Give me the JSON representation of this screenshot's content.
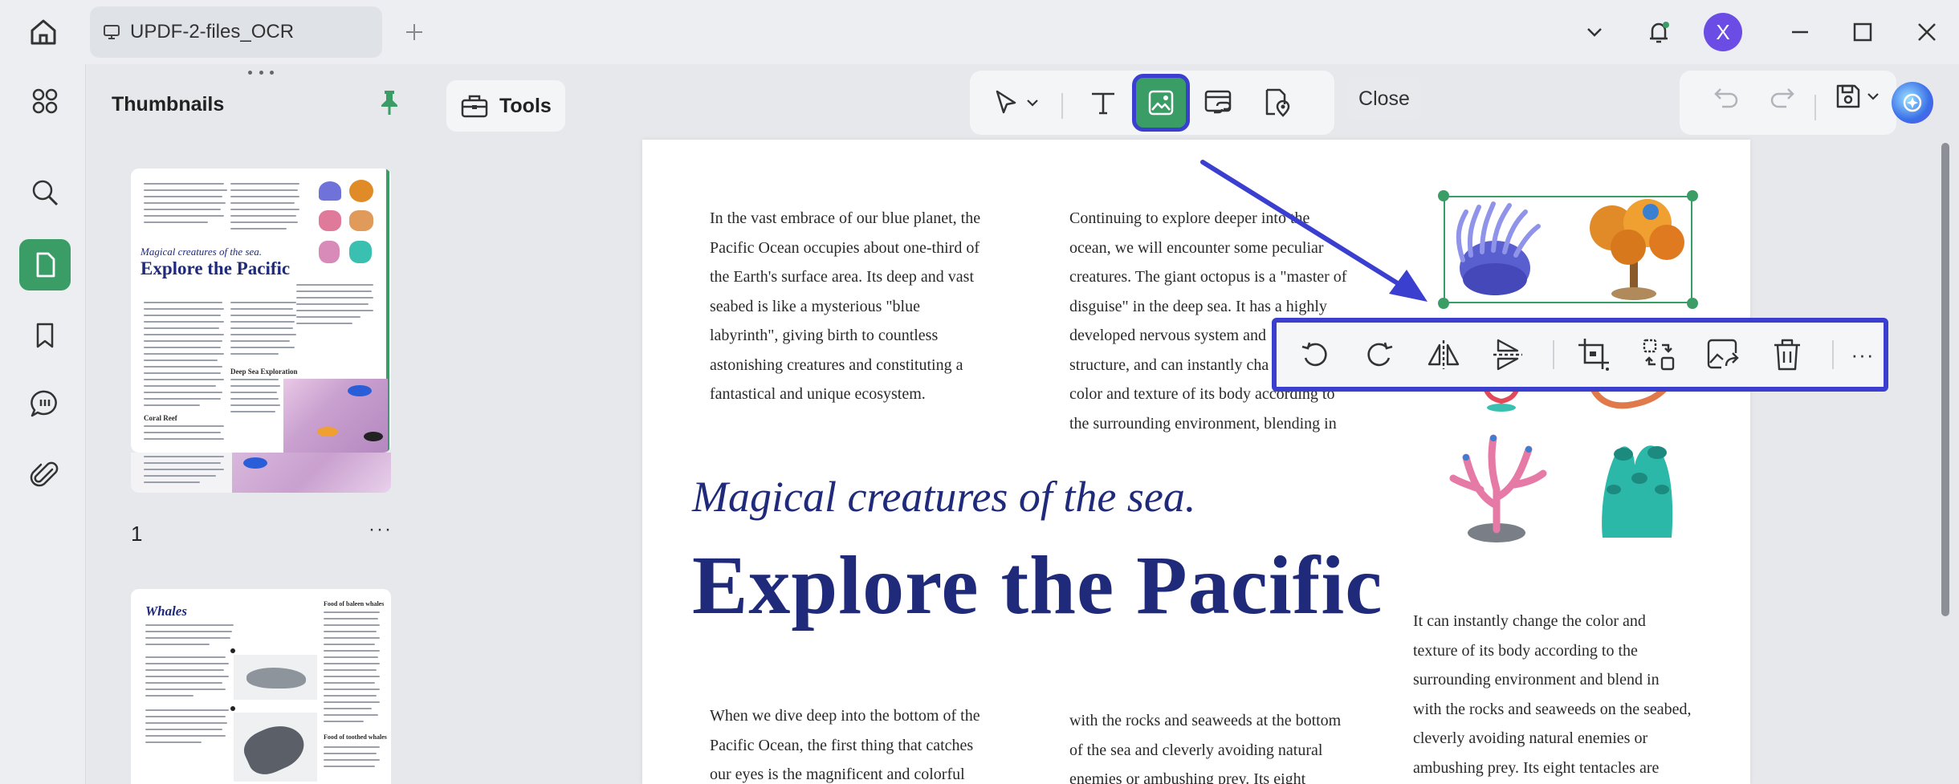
{
  "titlebar": {
    "tab_title": "UPDF-2-files_OCR",
    "avatar_letter": "X"
  },
  "rail": {
    "items": [
      "apps-icon",
      "search-icon",
      "page-icon",
      "bookmark-icon",
      "comment-icon",
      "attachment-icon"
    ],
    "active": "page-icon"
  },
  "thumbnails": {
    "title": "Thumbnails",
    "pages": [
      {
        "number": "1",
        "more": "···",
        "italic": "Magical creatures of the sea.",
        "heading": "Explore the Pacific",
        "subheading_1": "Deep Sea Exploration",
        "subheading_2": "Coral Reef"
      },
      {
        "heading": "Whales",
        "subheading_1": "Food of baleen whales",
        "subheading_2": "Food of toothed whales"
      }
    ]
  },
  "toolbar": {
    "tools_label": "Tools",
    "close_label": "Close"
  },
  "document": {
    "col1_para1": [
      "In the vast embrace of our blue planet, the",
      "Pacific Ocean occupies about one-third of",
      "the Earth's surface area. Its deep and vast",
      "seabed is like a mysterious \"blue",
      "labyrinth\", giving birth to countless",
      "astonishing creatures and constituting a",
      "fantastical and unique ecosystem."
    ],
    "col2_para1": [
      "Continuing to explore deeper into the",
      "ocean, we will encounter some peculiar",
      "creatures. The giant octopus is a \"master of",
      "disguise\" in the deep sea. It has a highly",
      "developed nervous system and",
      "structure, and can instantly cha",
      "color and texture of its body according to",
      "the surrounding environment, blending in"
    ],
    "italic_title": "Magical creatures of the sea.",
    "main_title": "Explore the Pacific",
    "col3_para": [
      "It can instantly change the color and",
      "texture of its body according to the",
      "surrounding environment and blend in",
      "with the rocks and seaweeds on the seabed,",
      "cleverly avoiding natural enemies or",
      "ambushing prey. Its eight tentacles are"
    ],
    "col1_para2": [
      "When we dive deep into the bottom of the",
      "Pacific Ocean, the first thing that catches",
      "our eyes is the magnificent and colorful"
    ],
    "col2_para2": [
      "with the rocks and seaweeds at the bottom",
      "of the sea and cleverly avoiding natural",
      "enemies or ambushing prey. Its eight"
    ]
  },
  "image_toolbar": {
    "buttons": [
      "rotate-left-icon",
      "rotate-right-icon",
      "flip-horizontal-icon",
      "flip-vertical-icon",
      "crop-icon",
      "replace-icon",
      "extract-icon",
      "delete-icon",
      "more-icon"
    ],
    "more": "···"
  },
  "colors": {
    "accent_green": "#3a9d66",
    "highlight_blue": "#3a3fd0",
    "title_navy": "#1f2a7a"
  }
}
